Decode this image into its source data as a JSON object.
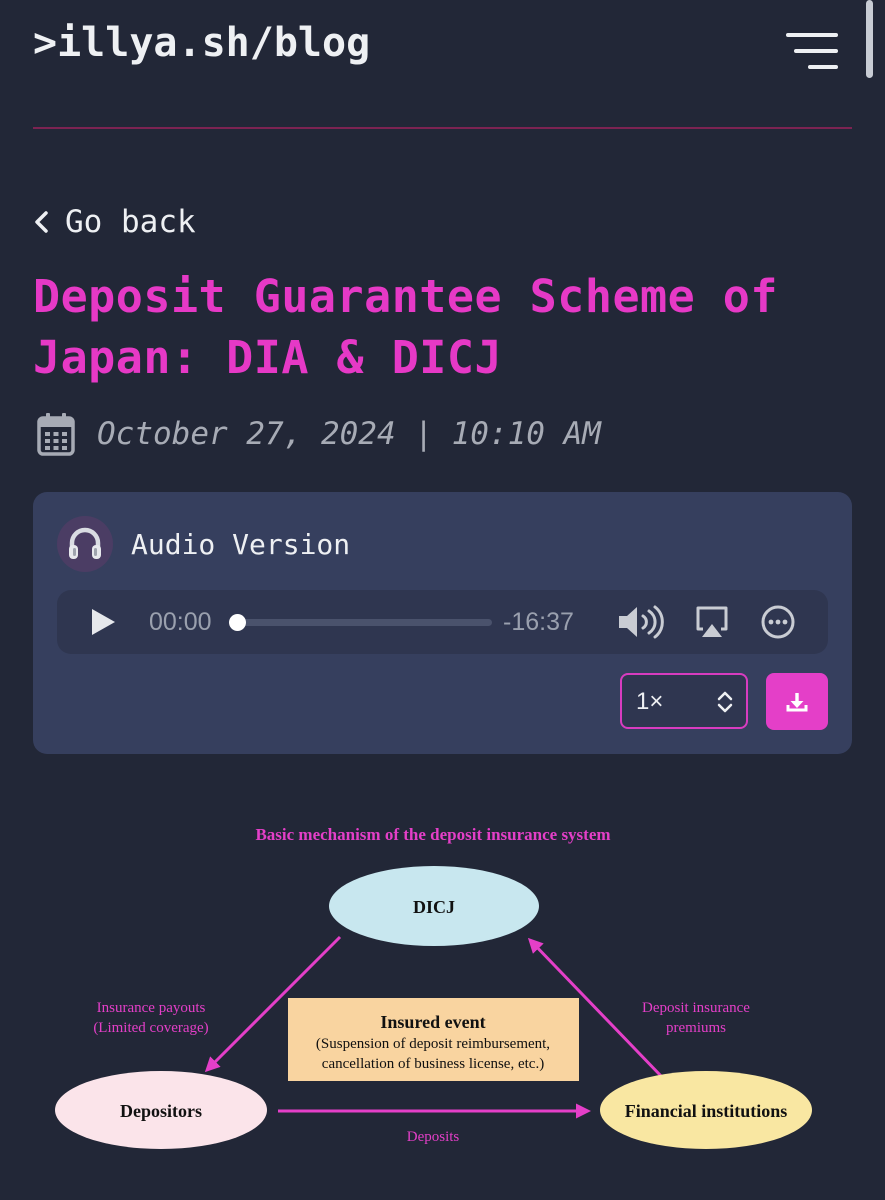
{
  "header": {
    "site_title": ">illya.sh/blog",
    "menu_icon": "hamburger-menu-icon"
  },
  "nav": {
    "back_label": "Go back",
    "back_icon": "chevron-left-icon"
  },
  "post": {
    "title": "Deposit Guarantee Scheme of Japan: DIA & DICJ",
    "date": "October 27, 2024 | 10:10 AM",
    "date_icon": "calendar-icon"
  },
  "audio": {
    "label": "Audio Version",
    "avatar_icon": "headphones-icon",
    "current_time": "00:00",
    "remaining_time": "-16:37",
    "progress": 0,
    "speed": "1×",
    "icons": [
      "play-icon",
      "volume-icon",
      "airplay-icon",
      "more-icon",
      "download-icon",
      "chevron-updown-icon"
    ]
  },
  "diagram": {
    "title": "Basic mechanism of the deposit insurance system",
    "nodes": {
      "dicj": "DICJ",
      "depositors": "Depositors",
      "institutions": "Financial institutions"
    },
    "insured_event": {
      "title": "Insured event",
      "line1": "(Suspension of deposit reimbursement,",
      "line2": "cancellation of business license, etc.)"
    },
    "edges": {
      "payouts_line1": "Insurance payouts",
      "payouts_line2": "(Limited coverage)",
      "premiums_line1": "Deposit insurance",
      "premiums_line2": "premiums",
      "deposits": "Deposits"
    }
  },
  "colors": {
    "background": "#222737",
    "accent": "#e639c6",
    "card": "#363f5e",
    "divider": "#7c2352",
    "dicj_fill": "#c8e7ef",
    "depositors_fill": "#fbe4ea",
    "institutions_fill": "#f9e7a2",
    "event_fill": "#f9d4a0"
  }
}
